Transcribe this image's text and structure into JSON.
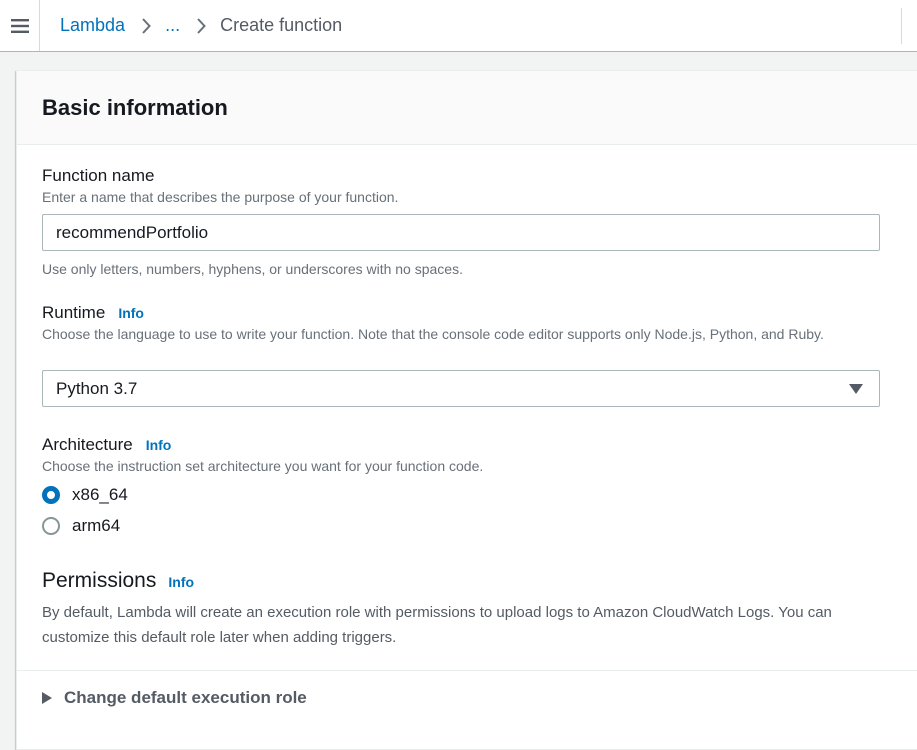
{
  "breadcrumb": {
    "items": [
      "Lambda",
      "...",
      "Create function"
    ]
  },
  "card": {
    "title": "Basic information"
  },
  "function_name": {
    "label": "Function name",
    "description": "Enter a name that describes the purpose of your function.",
    "value": "recommendPortfolio",
    "constraint": "Use only letters, numbers, hyphens, or underscores with no spaces."
  },
  "runtime": {
    "label": "Runtime",
    "info": "Info",
    "description": "Choose the language to use to write your function. Note that the console code editor supports only Node.js, Python, and Ruby.",
    "selected": "Python 3.7"
  },
  "architecture": {
    "label": "Architecture",
    "info": "Info",
    "description": "Choose the instruction set architecture you want for your function code.",
    "options": [
      {
        "label": "x86_64",
        "checked": true
      },
      {
        "label": "arm64",
        "checked": false
      }
    ]
  },
  "permissions": {
    "title": "Permissions",
    "info": "Info",
    "description": "By default, Lambda will create an execution role with permissions to upload logs to Amazon CloudWatch Logs. You can customize this default role later when adding triggers."
  },
  "execution_role": {
    "label": "Change default execution role"
  },
  "colors": {
    "link": "#0073bb",
    "text": "#16191f",
    "muted": "#687078",
    "border": "#aab7b8"
  }
}
